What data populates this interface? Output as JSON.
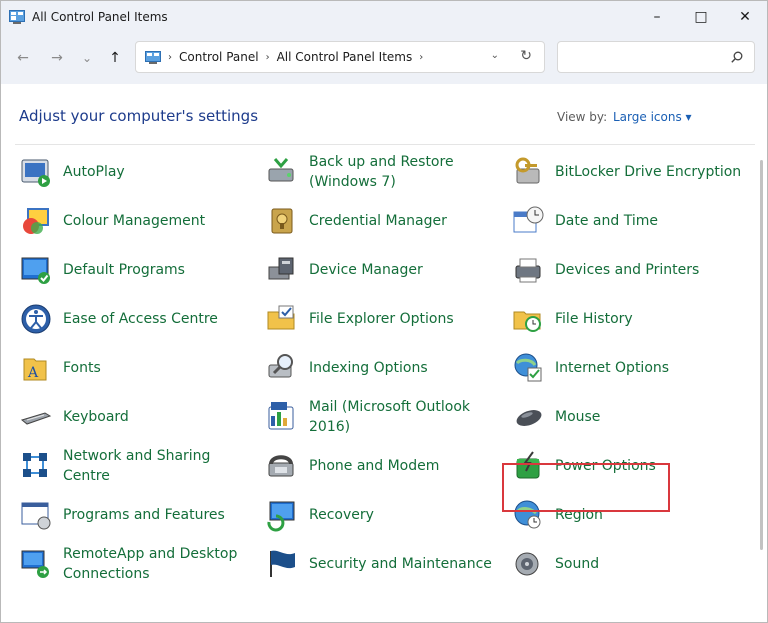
{
  "window": {
    "title": "All Control Panel Items",
    "minimize_glyph": "–",
    "maximize_glyph": "□",
    "close_glyph": "✕"
  },
  "nav": {
    "back_glyph": "←",
    "forward_glyph": "→",
    "recent_glyph": "⌄",
    "up_glyph": "↑"
  },
  "address": {
    "crumbs": [
      "Control Panel",
      "All Control Panel Items"
    ],
    "separator": "›",
    "dropdown_glyph": "⌄",
    "refresh_glyph": "↻"
  },
  "search": {
    "value": "",
    "placeholder": ""
  },
  "main": {
    "heading": "Adjust your computer's settings",
    "view_by_label": "View by:",
    "view_by_value": "Large icons ▾"
  },
  "items": [
    {
      "label": "AutoPlay",
      "icon": "autoplay-icon"
    },
    {
      "label": "Back up and Restore (Windows 7)",
      "icon": "backup-restore-icon"
    },
    {
      "label": "BitLocker Drive Encryption",
      "icon": "bitlocker-icon"
    },
    {
      "label": "Colour Management",
      "icon": "colour-management-icon"
    },
    {
      "label": "Credential Manager",
      "icon": "credential-manager-icon"
    },
    {
      "label": "Date and Time",
      "icon": "date-time-icon"
    },
    {
      "label": "Default Programs",
      "icon": "default-programs-icon"
    },
    {
      "label": "Device Manager",
      "icon": "device-manager-icon"
    },
    {
      "label": "Devices and Printers",
      "icon": "devices-printers-icon"
    },
    {
      "label": "Ease of Access Centre",
      "icon": "ease-of-access-icon"
    },
    {
      "label": "File Explorer Options",
      "icon": "file-explorer-options-icon"
    },
    {
      "label": "File History",
      "icon": "file-history-icon"
    },
    {
      "label": "Fonts",
      "icon": "fonts-icon"
    },
    {
      "label": "Indexing Options",
      "icon": "indexing-options-icon"
    },
    {
      "label": "Internet Options",
      "icon": "internet-options-icon"
    },
    {
      "label": "Keyboard",
      "icon": "keyboard-icon"
    },
    {
      "label": "Mail (Microsoft Outlook 2016)",
      "icon": "mail-icon"
    },
    {
      "label": "Mouse",
      "icon": "mouse-icon"
    },
    {
      "label": "Network and Sharing Centre",
      "icon": "network-sharing-icon"
    },
    {
      "label": "Phone and Modem",
      "icon": "phone-modem-icon"
    },
    {
      "label": "Power Options",
      "icon": "power-options-icon",
      "highlighted": true
    },
    {
      "label": "Programs and Features",
      "icon": "programs-features-icon"
    },
    {
      "label": "Recovery",
      "icon": "recovery-icon"
    },
    {
      "label": "Region",
      "icon": "region-icon"
    },
    {
      "label": "RemoteApp and Desktop Connections",
      "icon": "remoteapp-icon"
    },
    {
      "label": "Security and Maintenance",
      "icon": "security-maintenance-icon"
    },
    {
      "label": "Sound",
      "icon": "sound-icon"
    }
  ],
  "colors": {
    "link_green": "#146e3a",
    "heading_blue": "#1e3c8c",
    "highlight_red": "#d9383d"
  }
}
